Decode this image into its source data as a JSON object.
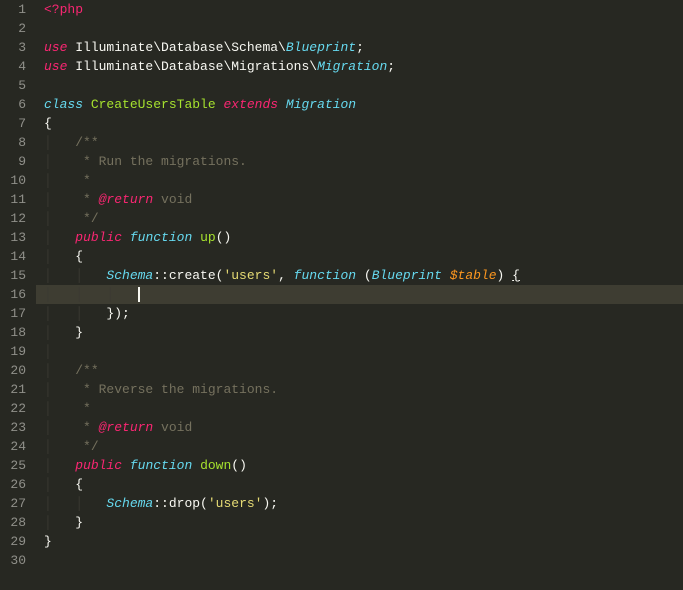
{
  "lineNumbers": [
    "1",
    "2",
    "3",
    "4",
    "5",
    "6",
    "7",
    "8",
    "9",
    "10",
    "11",
    "12",
    "13",
    "14",
    "15",
    "16",
    "17",
    "18",
    "19",
    "20",
    "21",
    "22",
    "23",
    "24",
    "25",
    "26",
    "27",
    "28",
    "29",
    "30"
  ],
  "code": {
    "l1_open": "<?php",
    "l3_use": "use",
    "l3_ns": "Illuminate\\Database\\Schema\\",
    "l3_class": "Blueprint",
    "l3_end": ";",
    "l4_use": "use",
    "l4_ns": "Illuminate\\Database\\Migrations\\",
    "l4_class": "Migration",
    "l4_end": ";",
    "l6_class": "class",
    "l6_name": "CreateUsersTable",
    "l6_extends": "extends",
    "l6_parent": "Migration",
    "l7_brace": "{",
    "l8_doc": "/**",
    "l9_doc": " * Run the migrations.",
    "l10_doc": " *",
    "l11_star": " * ",
    "l11_tag": "@return",
    "l11_ret": " void",
    "l12_doc": " */",
    "l13_public": "public",
    "l13_function": "function",
    "l13_name": "up",
    "l13_parens": "()",
    "l14_brace": "{",
    "l15_schema": "Schema",
    "l15_op": "::",
    "l15_create": "create(",
    "l15_str": "'users'",
    "l15_comma": ", ",
    "l15_func": "function",
    "l15_sp": " (",
    "l15_type": "Blueprint",
    "l15_sp2": " ",
    "l15_var": "$table",
    "l15_close": ") ",
    "l15_brace": "{",
    "l17_close": "});",
    "l18_brace": "}",
    "l20_doc": "/**",
    "l21_doc": " * Reverse the migrations.",
    "l22_doc": " *",
    "l23_star": " * ",
    "l23_tag": "@return",
    "l23_ret": " void",
    "l24_doc": " */",
    "l25_public": "public",
    "l25_function": "function",
    "l25_name": "down",
    "l25_parens": "()",
    "l26_brace": "{",
    "l27_schema": "Schema",
    "l27_op": "::",
    "l27_drop": "drop(",
    "l27_str": "'users'",
    "l27_close": ");",
    "l28_brace": "}",
    "l29_brace": "}"
  }
}
